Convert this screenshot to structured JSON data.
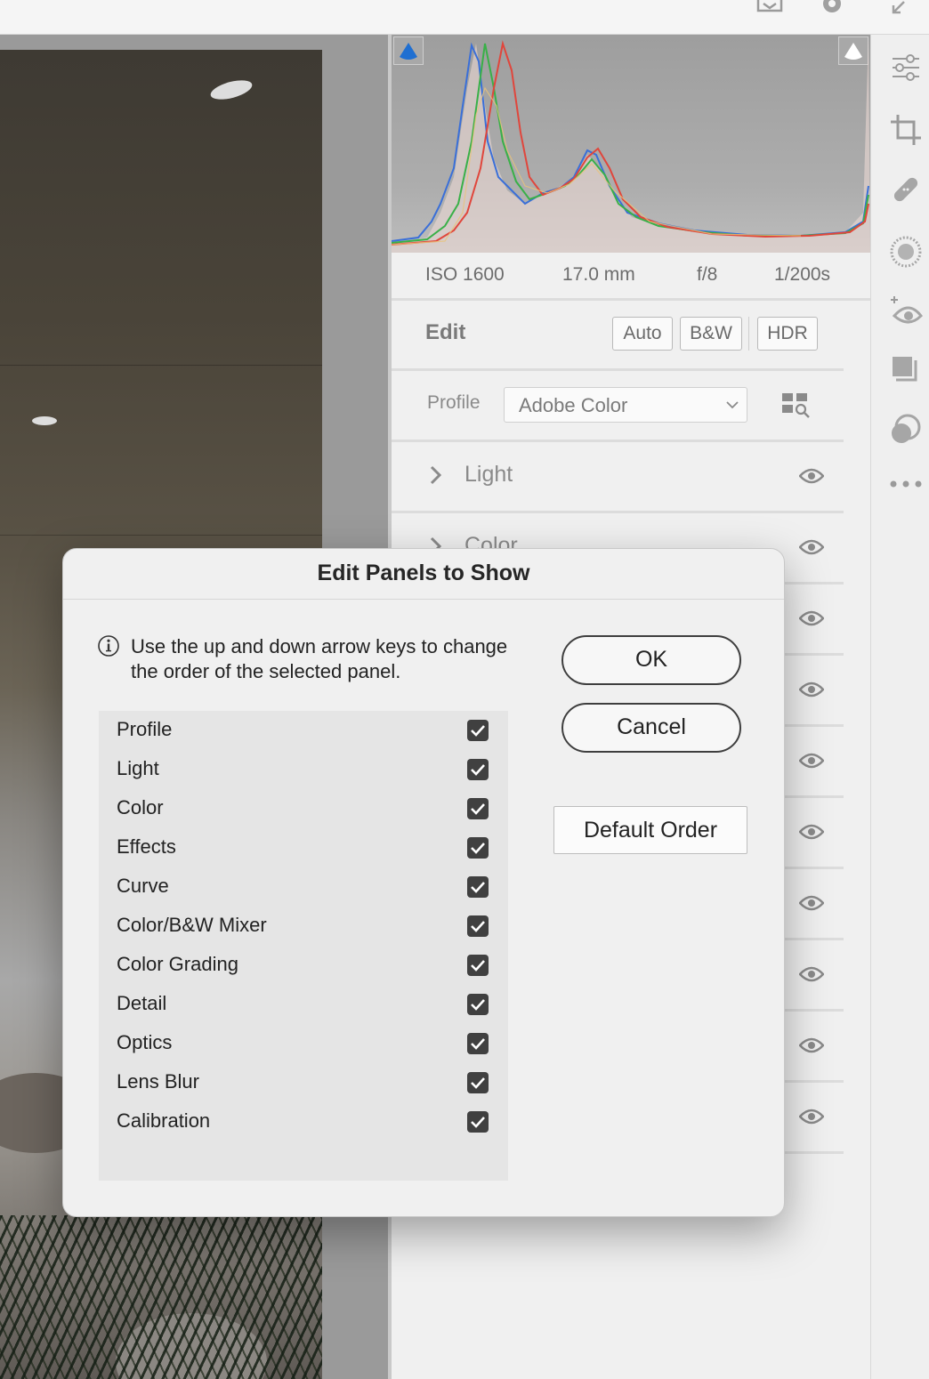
{
  "histogram_info": {
    "iso": "ISO 1600",
    "focal_length": "17.0 mm",
    "aperture": "f/8",
    "shutter": "1/200s"
  },
  "edit_panel": {
    "title": "Edit",
    "buttons": [
      "Auto",
      "B&W",
      "HDR"
    ],
    "profile_label": "Profile",
    "profile_value": "Adobe Color",
    "sections": [
      "Light",
      "Color"
    ]
  },
  "dialog": {
    "title": "Edit Panels to Show",
    "info_text": "Use the up and down arrow keys to change the order of the selected panel.",
    "panels": [
      {
        "label": "Profile",
        "checked": true
      },
      {
        "label": "Light",
        "checked": true
      },
      {
        "label": "Color",
        "checked": true
      },
      {
        "label": "Effects",
        "checked": true
      },
      {
        "label": "Curve",
        "checked": true
      },
      {
        "label": "Color/B&W Mixer",
        "checked": true
      },
      {
        "label": "Color Grading",
        "checked": true
      },
      {
        "label": "Detail",
        "checked": true
      },
      {
        "label": "Optics",
        "checked": true
      },
      {
        "label": "Lens Blur",
        "checked": true
      },
      {
        "label": "Calibration",
        "checked": true
      }
    ],
    "ok_label": "OK",
    "cancel_label": "Cancel",
    "default_order_label": "Default Order"
  },
  "toolbar_icons": [
    "edit-sliders-icon",
    "crop-icon",
    "healing-icon",
    "masking-icon",
    "red-eye-icon",
    "presets-icon",
    "versions-icon",
    "more-icon"
  ],
  "colors": {
    "checkbox": "#404040",
    "histogram_blue": "#3a6fd8",
    "histogram_red": "#e0463c",
    "histogram_green": "#39b048"
  }
}
